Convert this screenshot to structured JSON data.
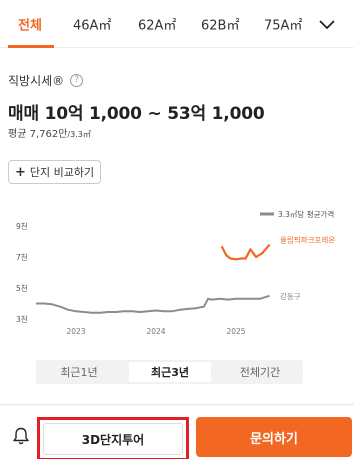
{
  "tabs": {
    "items": [
      {
        "label": "전체",
        "active": true
      },
      {
        "label": "46A㎡",
        "active": false
      },
      {
        "label": "62A㎡",
        "active": false
      },
      {
        "label": "62B㎡",
        "active": false
      },
      {
        "label": "75A㎡",
        "active": false
      }
    ],
    "more_icon": "chevron-down-icon"
  },
  "price_section": {
    "title": "직방시세®",
    "help_icon": "question-circle-icon",
    "range": "매매 10억 1,000 ~ 53억 1,000",
    "avg_label": "평균 7,762만",
    "avg_unit": "/3.3㎡"
  },
  "compare_button": {
    "label": "단지 비교하기",
    "icon": "plus-icon"
  },
  "chart_data": {
    "type": "line",
    "legend": {
      "label": "3.3㎡당 평균가격",
      "position": "top-right"
    },
    "y_ticks": [
      "9천",
      "7천",
      "5천",
      "3천"
    ],
    "x_ticks": [
      "2023",
      "2024",
      "2025"
    ],
    "ylim": [
      3000,
      9000
    ],
    "grid": false,
    "series": [
      {
        "name": "올림픽파크포레온",
        "color": "#f26722",
        "x": [
          2024.82,
          2024.88,
          2024.93,
          2025.0,
          2025.07,
          2025.12,
          2025.18,
          2025.25,
          2025.33,
          2025.42
        ],
        "values": [
          7700,
          7100,
          6900,
          6850,
          6900,
          6900,
          7500,
          7000,
          7250,
          7800
        ]
      },
      {
        "name": "강동구",
        "color": "#8c8c8c",
        "x": [
          2022.5,
          2022.6,
          2022.7,
          2022.8,
          2022.9,
          2023.0,
          2023.1,
          2023.2,
          2023.3,
          2023.4,
          2023.5,
          2023.6,
          2023.7,
          2023.8,
          2023.9,
          2024.0,
          2024.1,
          2024.2,
          2024.3,
          2024.4,
          2024.5,
          2024.6,
          2024.65,
          2024.7,
          2024.8,
          2024.9,
          2025.0,
          2025.1,
          2025.2,
          2025.3,
          2025.42
        ],
        "values": [
          4000,
          4000,
          3950,
          3800,
          3600,
          3500,
          3450,
          3400,
          3400,
          3450,
          3450,
          3500,
          3500,
          3450,
          3500,
          3550,
          3500,
          3500,
          3600,
          3650,
          3700,
          3800,
          4300,
          4250,
          4300,
          4250,
          4300,
          4300,
          4300,
          4300,
          4500
        ]
      }
    ]
  },
  "period_tabs": {
    "items": [
      {
        "label": "최근1년",
        "active": false
      },
      {
        "label": "최근3년",
        "active": true
      },
      {
        "label": "전체기간",
        "active": false
      }
    ]
  },
  "bottom_bar": {
    "bell_icon": "bell-icon",
    "tour_label": "3D단지투어",
    "inquiry_label": "문의하기",
    "accent": "#f26722",
    "highlight": "#e31e24"
  }
}
